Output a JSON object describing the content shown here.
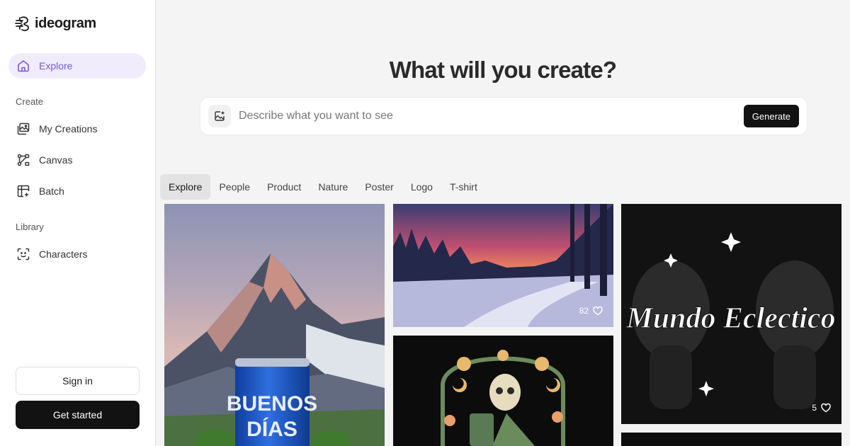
{
  "app": {
    "name": "ideogram"
  },
  "sidebar": {
    "explore": {
      "label": "Explore",
      "icon": "home-icon"
    },
    "create_section": "Create",
    "create_items": [
      {
        "label": "My Creations",
        "icon": "gallery-icon"
      },
      {
        "label": "Canvas",
        "icon": "canvas-icon"
      },
      {
        "label": "Batch",
        "icon": "batch-icon"
      }
    ],
    "library_section": "Library",
    "library_items": [
      {
        "label": "Characters",
        "icon": "character-face-icon"
      }
    ],
    "signin_label": "Sign in",
    "get_started_label": "Get started"
  },
  "hero": {
    "title": "What will you create?"
  },
  "prompt": {
    "placeholder": "Describe what you want to see",
    "value": "",
    "generate_label": "Generate",
    "upload_icon": "image-upload-icon"
  },
  "tabs": [
    "Explore",
    "People",
    "Product",
    "Nature",
    "Poster",
    "Logo",
    "T-shirt"
  ],
  "active_tab": "Explore",
  "gallery": {
    "cards": [
      {
        "subject": "mountain-soda-can",
        "can_text_1": "BUENOS",
        "can_text_2": "DÍAS"
      },
      {
        "subject": "snowy-forest-sunset",
        "likes": "82"
      },
      {
        "subject": "skeleton-jar-art"
      },
      {
        "subject": "mundo-eclectico-typography",
        "lettering": "Mundo Eclectico",
        "likes": "5"
      }
    ]
  },
  "colors": {
    "accent": "#7a5bd4",
    "active_bg": "#f0ecfb",
    "button_dark": "#121212"
  }
}
